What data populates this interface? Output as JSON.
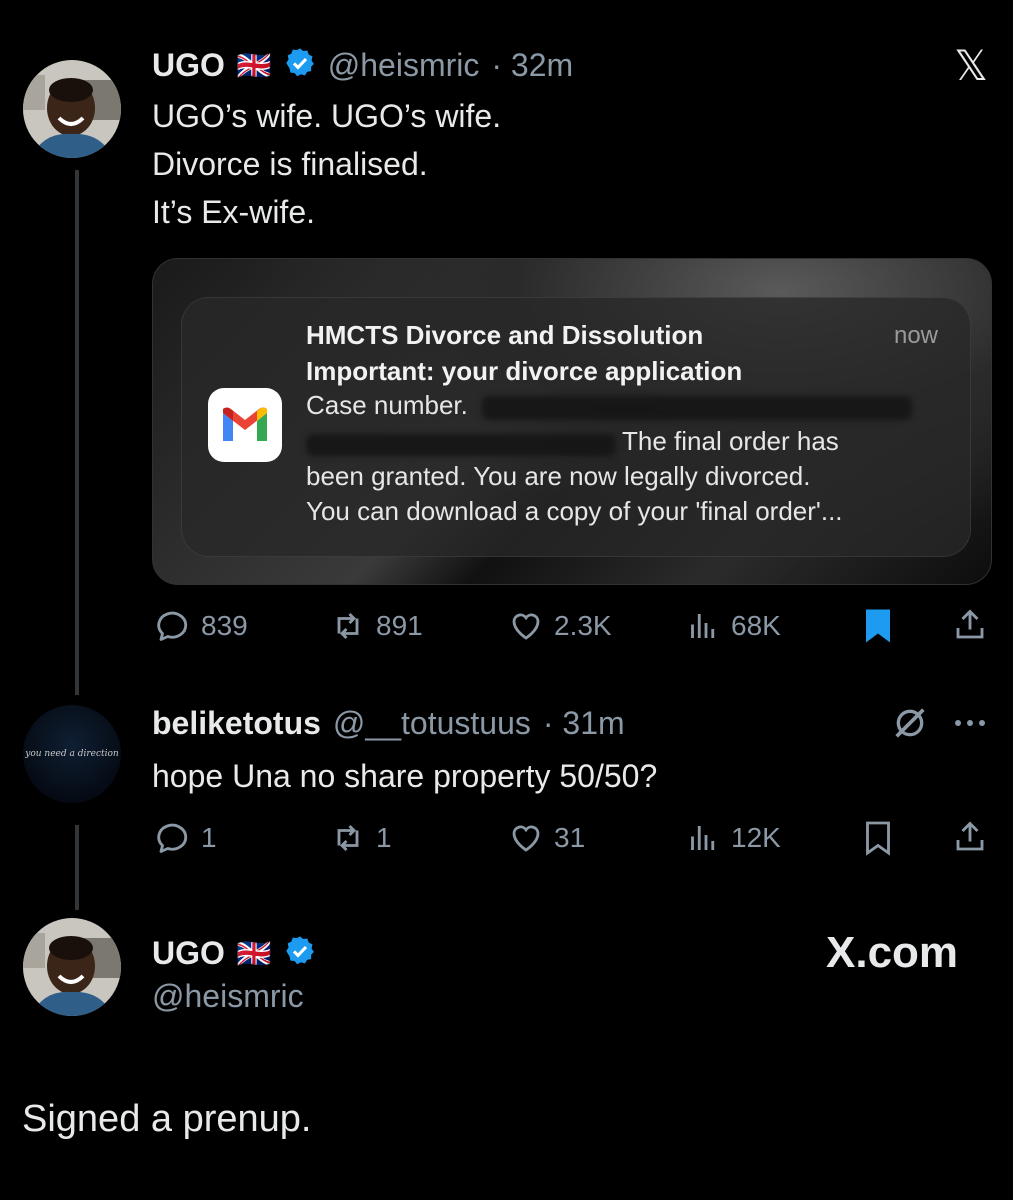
{
  "tweet1": {
    "name": "UGO",
    "flag": "🇬🇧",
    "handle": "@heismric",
    "time": "· 32m",
    "text": "UGO’s wife. UGO’s wife.\nDivorce is finalised.\nIt’s Ex-wife.",
    "notification": {
      "app": "gmail",
      "sender": "HMCTS Divorce and Dissolution",
      "time": "now",
      "subject": "Important: your divorce application",
      "case_label": "Case number.",
      "line2_tail": "The final order has",
      "line3": "been granted. You are now legally divorced.",
      "line4": "You can download a copy of your 'final order'..."
    },
    "actions": {
      "replies": "839",
      "reposts": "891",
      "likes": "2.3K",
      "views": "68K"
    },
    "bookmark_color": "#1d9bf0"
  },
  "tweet2": {
    "name": "beliketotus",
    "handle": "@__totustuus",
    "time": "· 31m",
    "avatar_text": "you need a direction",
    "text": "hope Una no share property 50/50?",
    "actions": {
      "replies": "1",
      "reposts": "1",
      "likes": "31",
      "views": "12K"
    }
  },
  "tweet3": {
    "name": "UGO",
    "flag": "🇬🇧",
    "handle": "@heismric",
    "brand": "X.com",
    "text": "Signed a prenup."
  },
  "header": {
    "close_label": "𝕏"
  }
}
